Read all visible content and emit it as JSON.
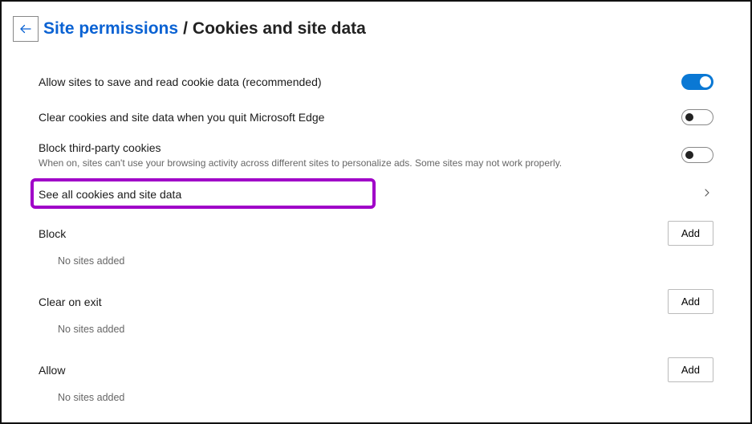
{
  "header": {
    "breadcrumb_link": "Site permissions",
    "breadcrumb_sep": "/",
    "breadcrumb_current": "Cookies and site data"
  },
  "settings": {
    "allow_cookies": {
      "label": "Allow sites to save and read cookie data (recommended)",
      "value": true
    },
    "clear_on_quit": {
      "label": "Clear cookies and site data when you quit Microsoft Edge",
      "value": false
    },
    "block_third_party": {
      "label": "Block third-party cookies",
      "desc": "When on, sites can't use your browsing activity across different sites to personalize ads. Some sites may not work properly.",
      "value": false
    },
    "see_all": {
      "label": "See all cookies and site data"
    }
  },
  "sections": {
    "block": {
      "title": "Block",
      "empty": "No sites added",
      "add": "Add"
    },
    "clear_on_exit": {
      "title": "Clear on exit",
      "empty": "No sites added",
      "add": "Add"
    },
    "allow": {
      "title": "Allow",
      "empty": "No sites added",
      "add": "Add"
    }
  }
}
